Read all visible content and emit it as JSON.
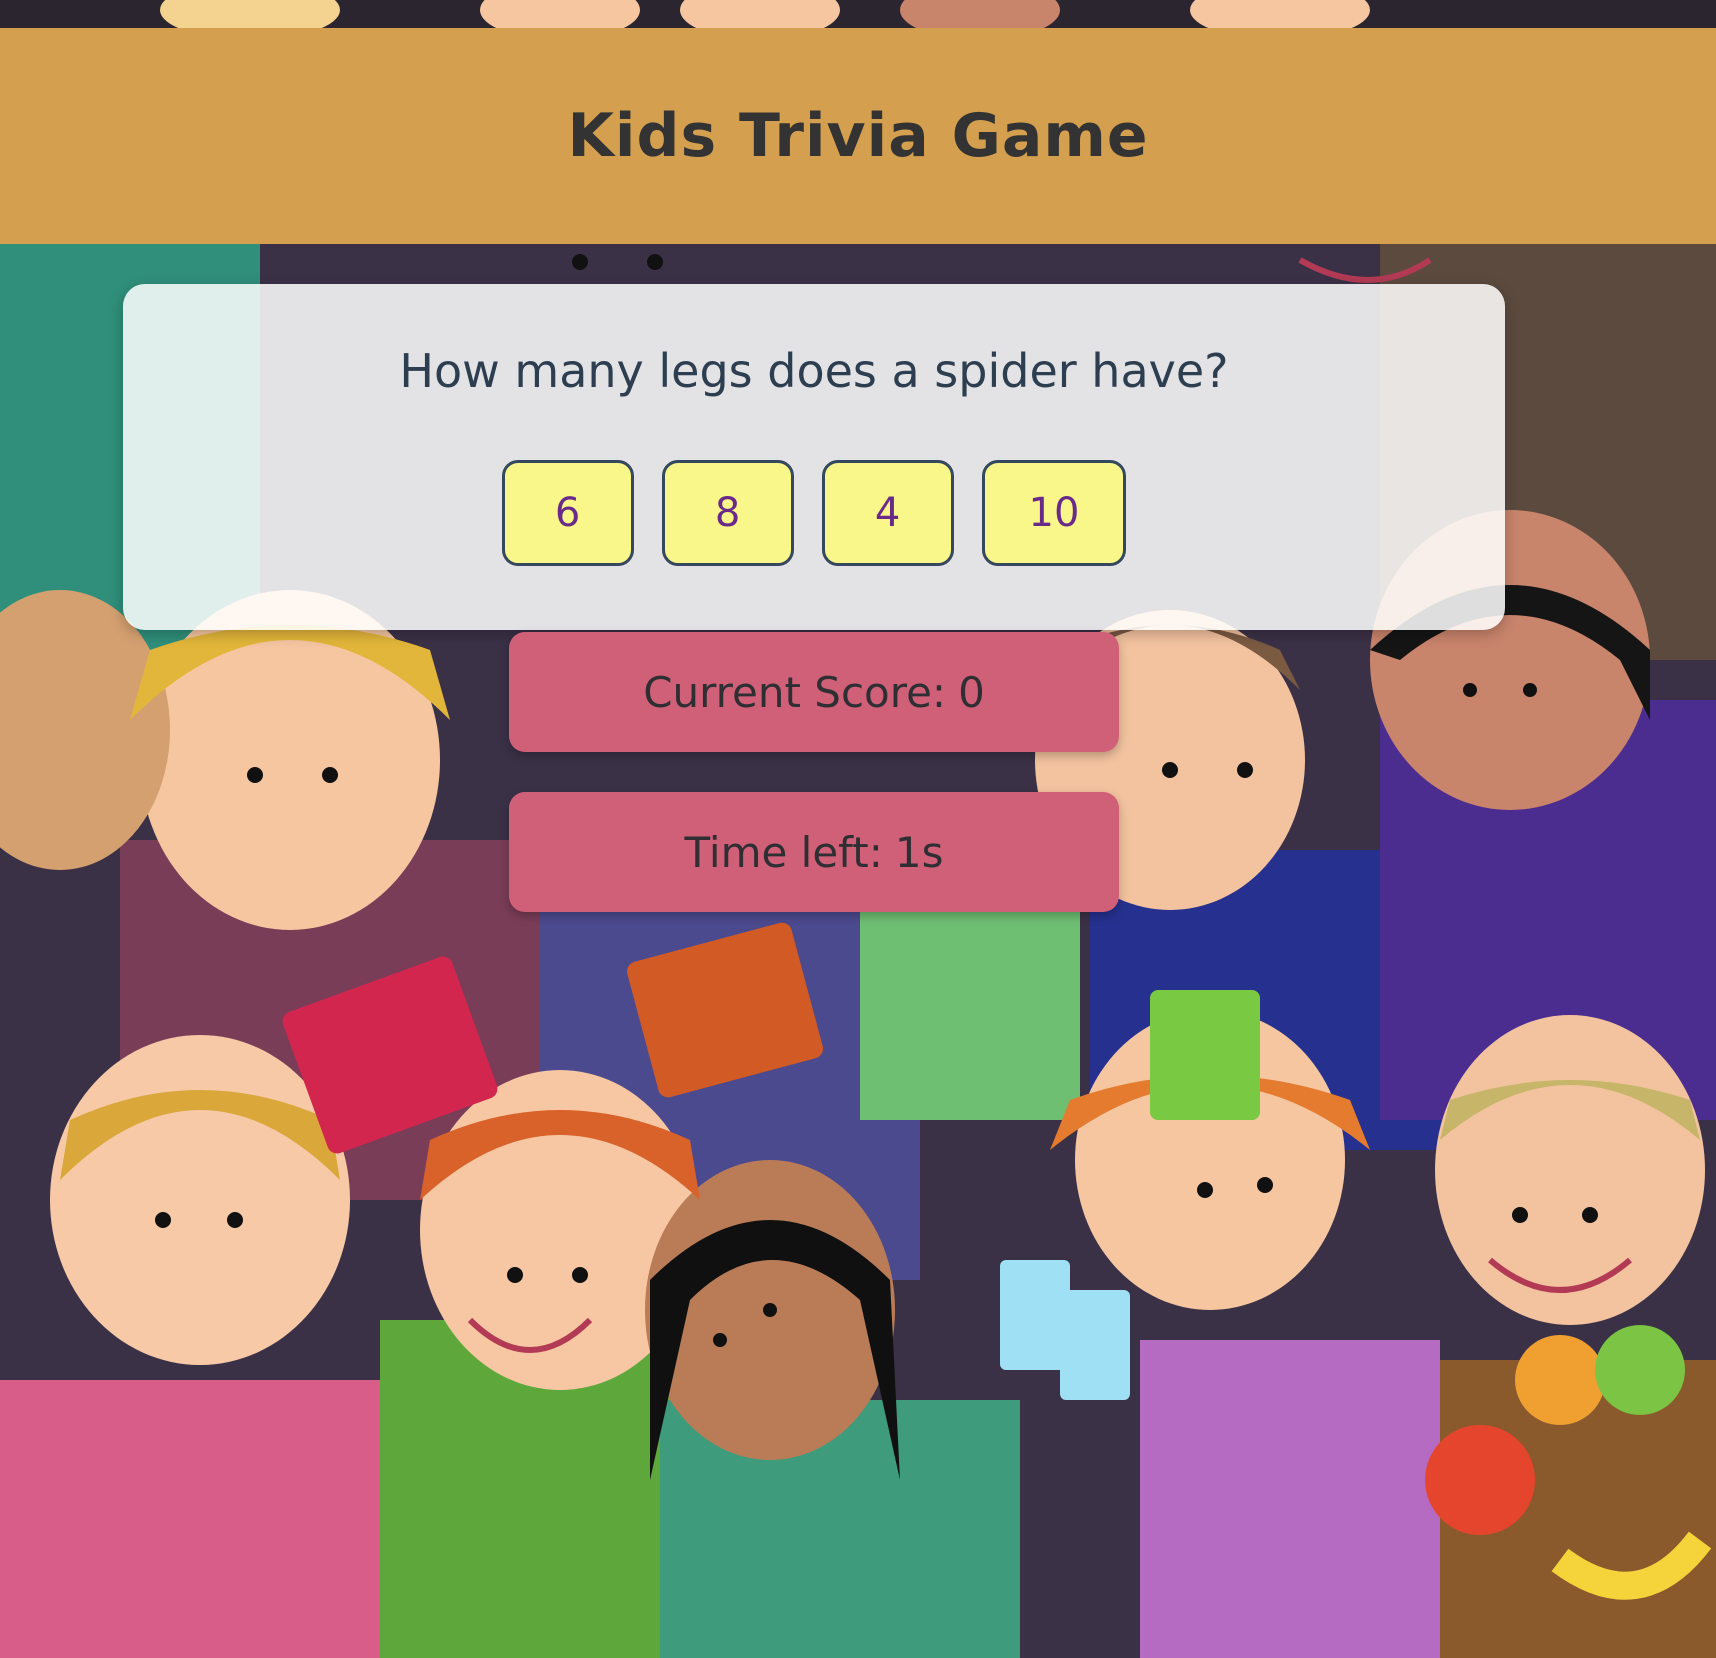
{
  "header": {
    "title": "Kids Trivia Game"
  },
  "quiz": {
    "question": "How many legs does a spider have?",
    "answers": [
      "6",
      "8",
      "4",
      "10"
    ]
  },
  "status": {
    "score_label": "Current Score:",
    "score_value": "0",
    "time_label": "Time left:",
    "time_value": "1s"
  },
  "colors": {
    "header_bg": "#d4a04f",
    "answer_bg": "#f9f68a",
    "answer_text": "#6a2a8a",
    "pill_bg": "#d06078"
  },
  "background": {
    "image": "cartoon-kids-crowd-illustration"
  }
}
